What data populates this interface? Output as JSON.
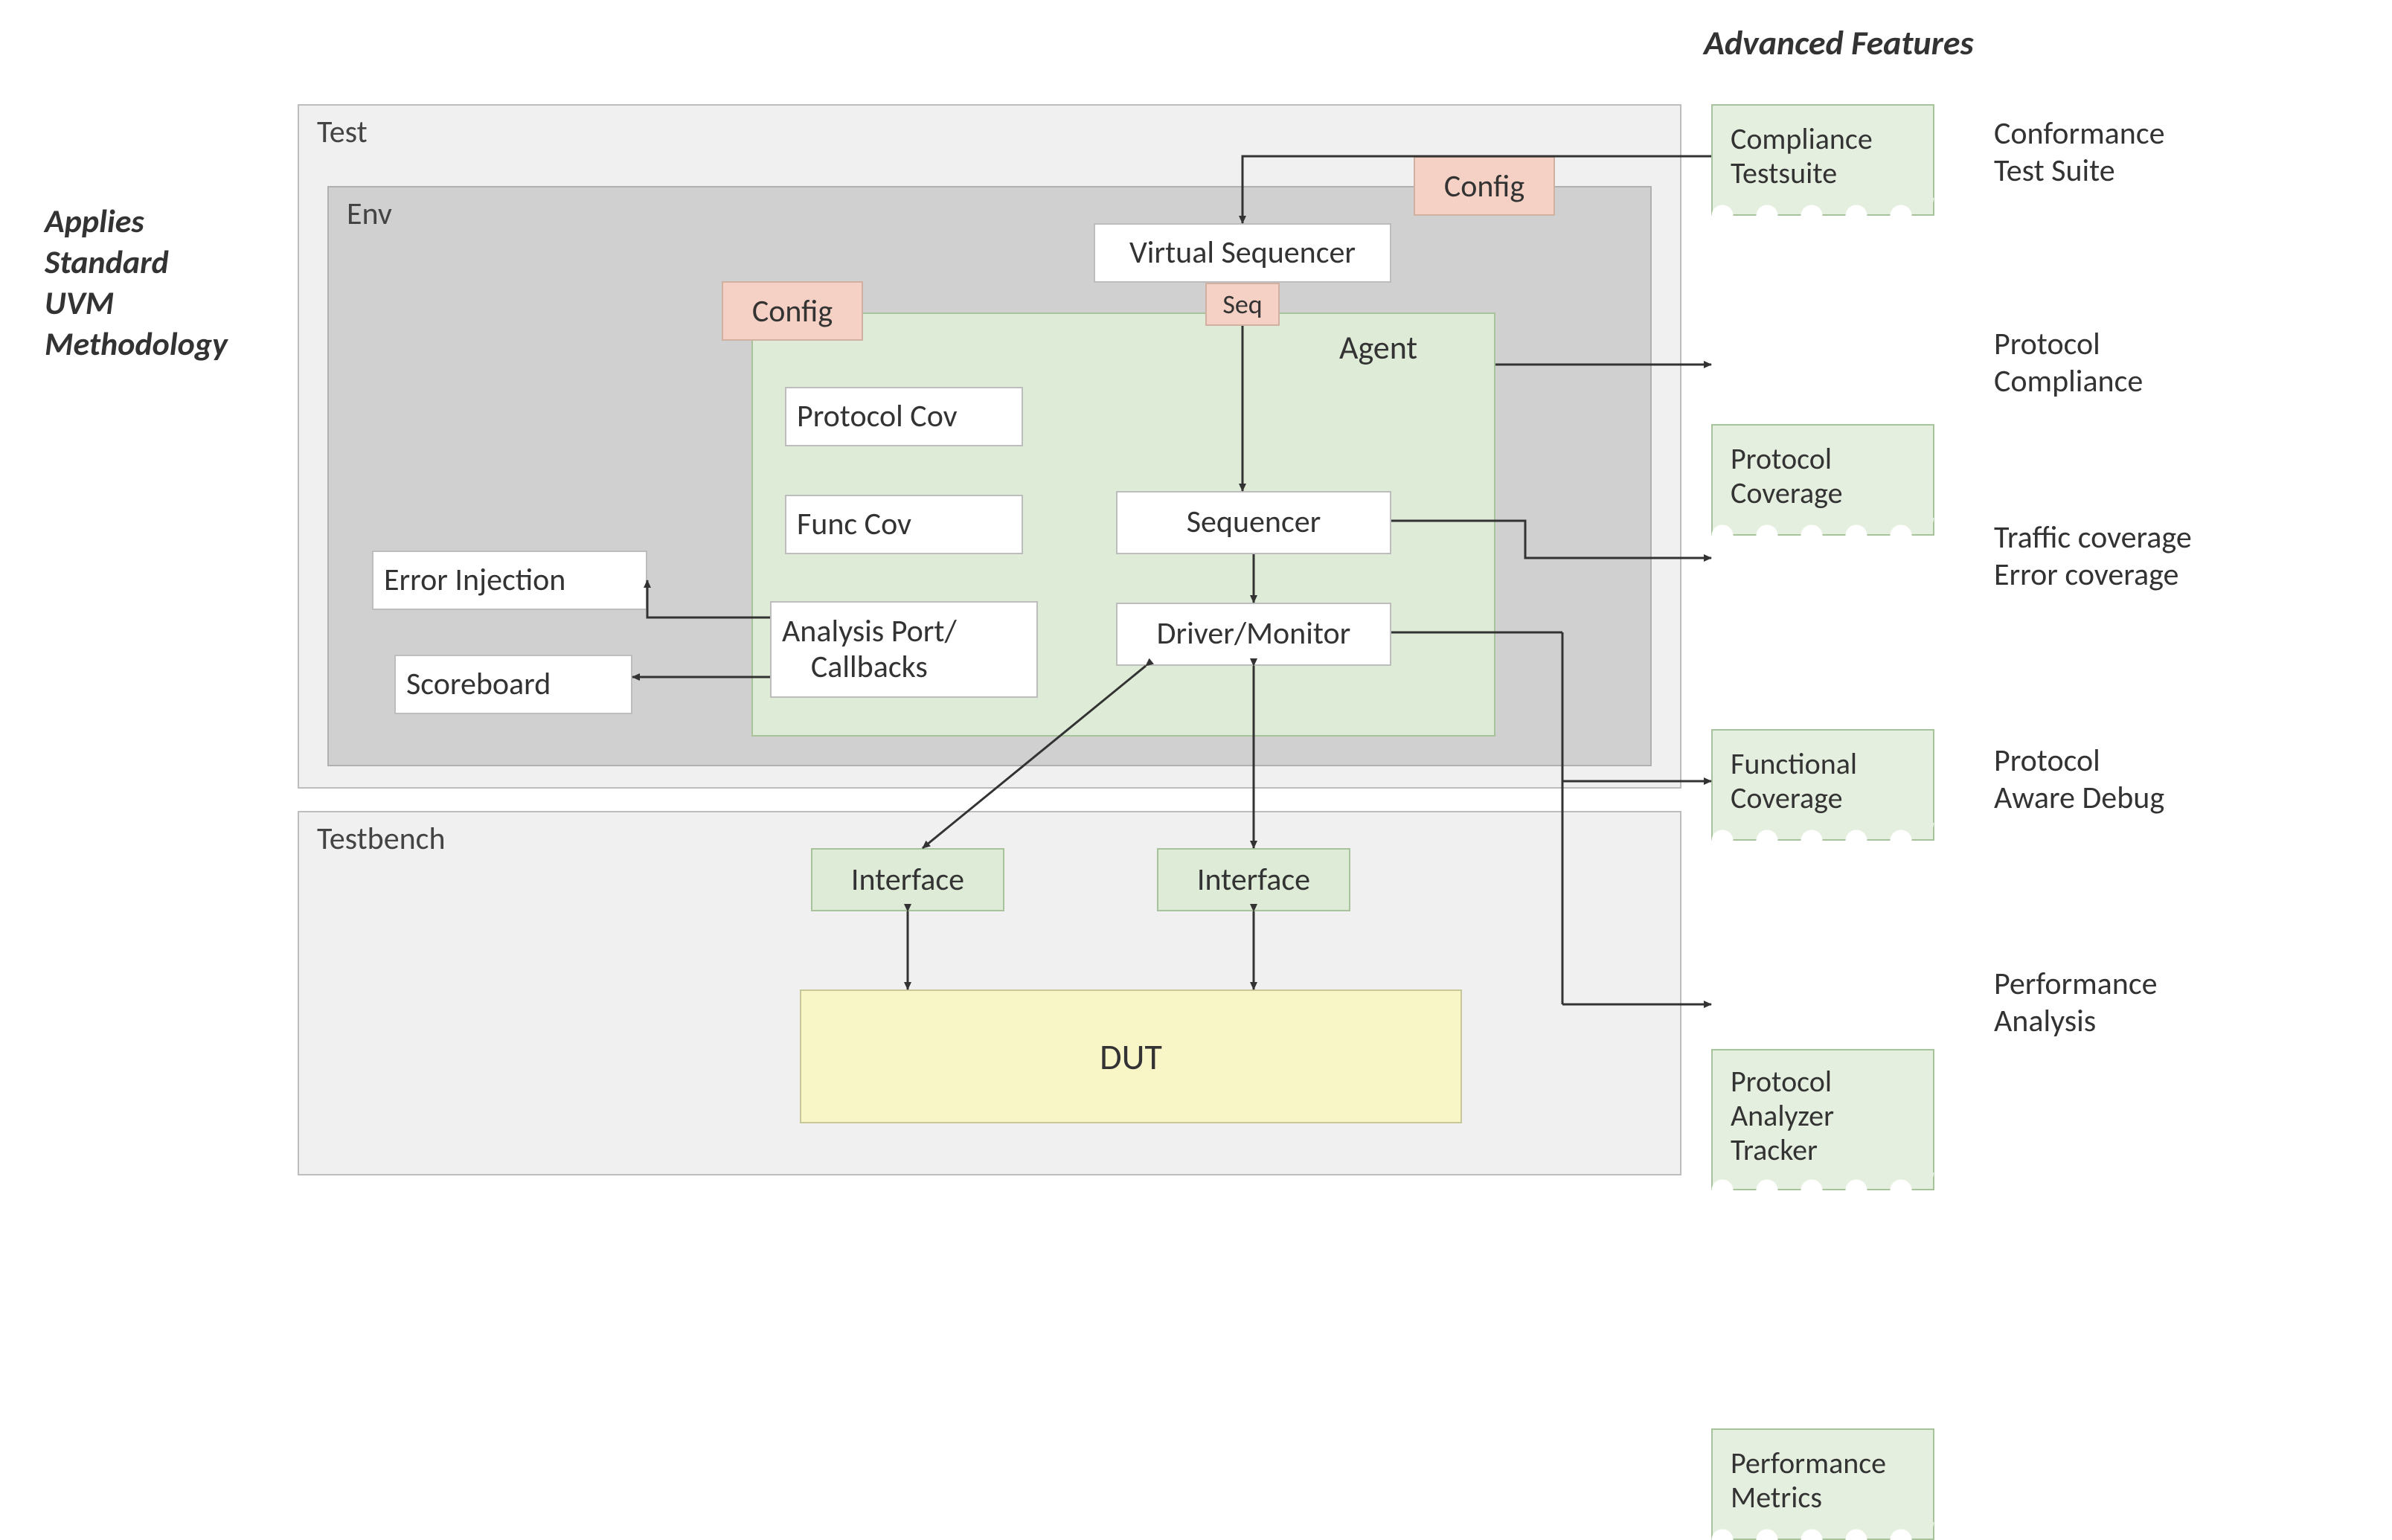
{
  "sideLeft": "Applies\nStandard\nUVM\nMethodology",
  "advancedTitle": "Advanced Features",
  "test": {
    "title": "Test",
    "env": {
      "title": "Env",
      "configEnv": "Config",
      "configAgent": "Config",
      "virtualSequencer": "Virtual Sequencer",
      "seq": "Seq",
      "agent": {
        "title": "Agent",
        "protocolCov": "Protocol Cov",
        "funcCov": "Func Cov",
        "analysisPort": "Analysis Port/\nCallbacks",
        "sequencer": "Sequencer",
        "driverMonitor": "Driver/Monitor"
      },
      "errorInjection": "Error Injection",
      "scoreboard": "Scoreboard"
    }
  },
  "testbench": {
    "title": "Testbench",
    "interface1": "Interface",
    "interface2": "Interface",
    "dut": "DUT"
  },
  "features": [
    {
      "note": "Compliance\nTestsuite",
      "desc": "Conformance\nTest Suite"
    },
    {
      "note": "Protocol\nCoverage",
      "desc": "Protocol\nCompliance"
    },
    {
      "note": "Functional\nCoverage",
      "desc": "Traffic coverage\nError coverage"
    },
    {
      "note": "Protocol\nAnalyzer\nTracker",
      "desc": "Protocol\nAware Debug"
    },
    {
      "note": "Performance\nMetrics",
      "desc": "Performance\nAnalysis"
    }
  ]
}
